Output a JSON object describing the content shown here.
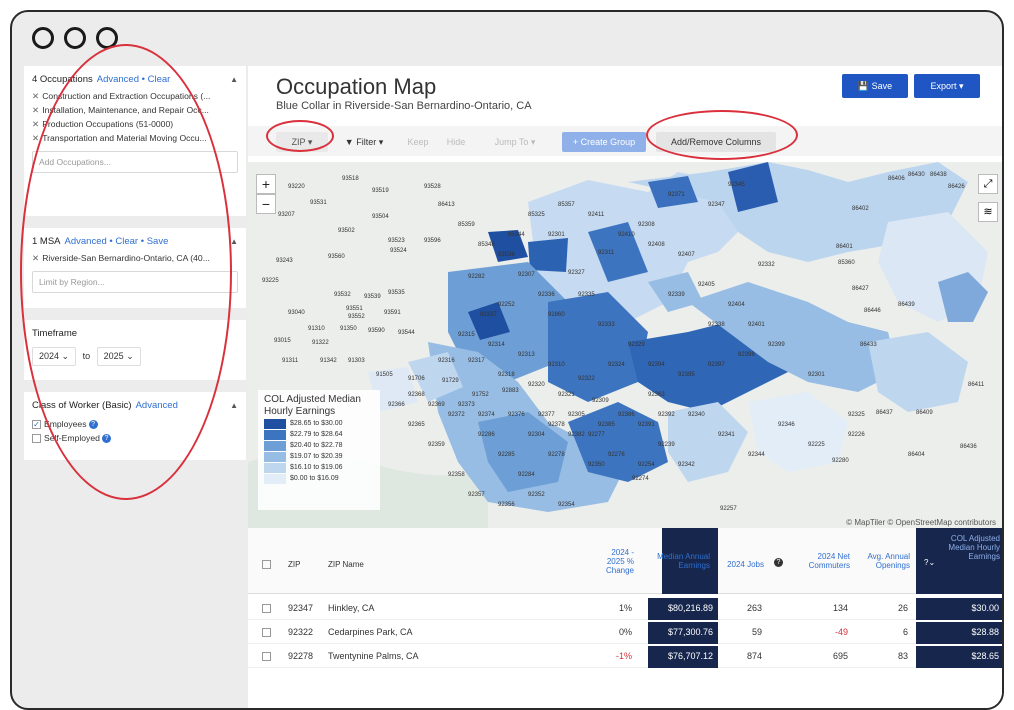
{
  "window": {
    "controls": [
      "close-dot",
      "minimize-dot",
      "zoom-dot"
    ]
  },
  "sidebar": {
    "occupations": {
      "count_label": "4 Occupations",
      "advanced": "Advanced",
      "clear": "• Clear",
      "items": [
        "Construction and Extraction Occupations (...",
        "Installation, Maintenance, and Repair Occ...",
        "Production Occupations (51-0000)",
        "Transportation and Material Moving Occu..."
      ],
      "placeholder": "Add Occupations..."
    },
    "msa": {
      "count_label": "1 MSA",
      "advanced": "Advanced",
      "clear": "• Clear",
      "save": "• Save",
      "items": [
        "Riverside-San Bernardino-Ontario, CA (40..."
      ],
      "placeholder": "Limit by Region..."
    },
    "timeframe": {
      "label": "Timeframe",
      "start": "2024",
      "to": "to",
      "end": "2025"
    },
    "class_of_worker": {
      "label": "Class of Worker (Basic)",
      "advanced": "Advanced",
      "options": [
        {
          "label": "Employees",
          "checked": true
        },
        {
          "label": "Self-Employed",
          "checked": false
        }
      ]
    }
  },
  "main": {
    "title": "Occupation Map",
    "subtitle": "Blue Collar in Riverside-San Bernardino-Ontario, CA",
    "save": "Save",
    "export": "Export ▾",
    "toolbar": {
      "zip": "ZIP ▾",
      "filter": "Filter ▾",
      "keep": "Keep",
      "hide": "Hide",
      "jump_to": "Jump To ▾",
      "create_group": "+ Create Group",
      "add_remove": "Add/Remove Columns"
    },
    "map": {
      "zoom_in": "+",
      "zoom_out": "−",
      "legend_title": "COL Adjusted Median Hourly Earnings",
      "legend": [
        {
          "range": "$28.65 to $30.00",
          "color": "#1f4fa0"
        },
        {
          "range": "$22.79 to $28.64",
          "color": "#3d74bf"
        },
        {
          "range": "$20.40 to $22.78",
          "color": "#6d9fd6"
        },
        {
          "range": "$19.07 to $20.39",
          "color": "#97bde4"
        },
        {
          "range": "$16.10 to $19.06",
          "color": "#bfd6ef"
        },
        {
          "range": "$0.00 to $16.09",
          "color": "#e2edf8"
        }
      ],
      "attribution": "© MapTiler © OpenStreetMap contributors",
      "labels": [
        "93220",
        "93518",
        "93519",
        "93528",
        "93207",
        "93531",
        "93504",
        "93502",
        "93523",
        "93596",
        "93560",
        "93524",
        "93243",
        "93225",
        "93532",
        "93539",
        "93535",
        "93040",
        "93551",
        "93552",
        "93591",
        "91310",
        "91350",
        "93590",
        "93544",
        "91322",
        "93015",
        "91311",
        "91342",
        "91303",
        "91505",
        "91706",
        "91729",
        "91752",
        "92883",
        "92860",
        "92536",
        "92282",
        "92252",
        "92307",
        "92301",
        "92345",
        "92347",
        "92371",
        "92308",
        "92311",
        "92327",
        "92332",
        "92338",
        "92363",
        "92301",
        "92280",
        "92325",
        "92225",
        "92226",
        "92239",
        "92254",
        "92257",
        "92274",
        "92276",
        "92277",
        "92278",
        "92284",
        "92285",
        "92286",
        "92304",
        "92305",
        "92309",
        "92310",
        "92313",
        "92314",
        "92315",
        "92316",
        "92317",
        "92318",
        "92320",
        "92321",
        "92322",
        "92324",
        "92329",
        "92333",
        "92335",
        "92336",
        "92337",
        "92339",
        "92340",
        "92341",
        "92342",
        "92344",
        "92346",
        "92350",
        "92352",
        "92354",
        "92356",
        "92357",
        "92358",
        "92359",
        "92365",
        "92366",
        "92368",
        "92369",
        "92372",
        "92373",
        "92374",
        "92376",
        "92377",
        "92378",
        "92382",
        "92385",
        "92386",
        "92391",
        "92392",
        "92394",
        "92395",
        "92397",
        "92398",
        "92399",
        "92401",
        "92404",
        "92405",
        "92407",
        "92408",
        "92410",
        "92411",
        "85357",
        "85325",
        "85344",
        "85348",
        "85359",
        "86413",
        "86411",
        "86409",
        "86437",
        "86436",
        "86404",
        "86406",
        "86438",
        "86430",
        "86426",
        "86427",
        "86446",
        "86433",
        "86439",
        "86402",
        "86401",
        "85360"
      ]
    },
    "table": {
      "headers": {
        "zip": "ZIP",
        "zip_name": "ZIP Name",
        "change": "2024 - 2025 % Change",
        "median_annual": "Median Annual Earnings",
        "jobs": "2024 Jobs",
        "net_commuters": "2024 Net Commuters",
        "openings": "Avg. Annual Openings",
        "col_adjusted": "COL Adjusted Median Hourly Earnings"
      },
      "rows": [
        {
          "zip": "92347",
          "name": "Hinkley, CA",
          "change": "1%",
          "median": "$80,216.89",
          "jobs": "263",
          "commuters": "134",
          "openings": "26",
          "col": "$30.00"
        },
        {
          "zip": "92322",
          "name": "Cedarpines Park, CA",
          "change": "0%",
          "median": "$77,300.76",
          "jobs": "59",
          "commuters": "-49",
          "openings": "6",
          "col": "$28.88"
        },
        {
          "zip": "92278",
          "name": "Twentynine Palms, CA",
          "change": "-1%",
          "median": "$76,707.12",
          "jobs": "874",
          "commuters": "695",
          "openings": "83",
          "col": "$28.65"
        }
      ]
    }
  }
}
